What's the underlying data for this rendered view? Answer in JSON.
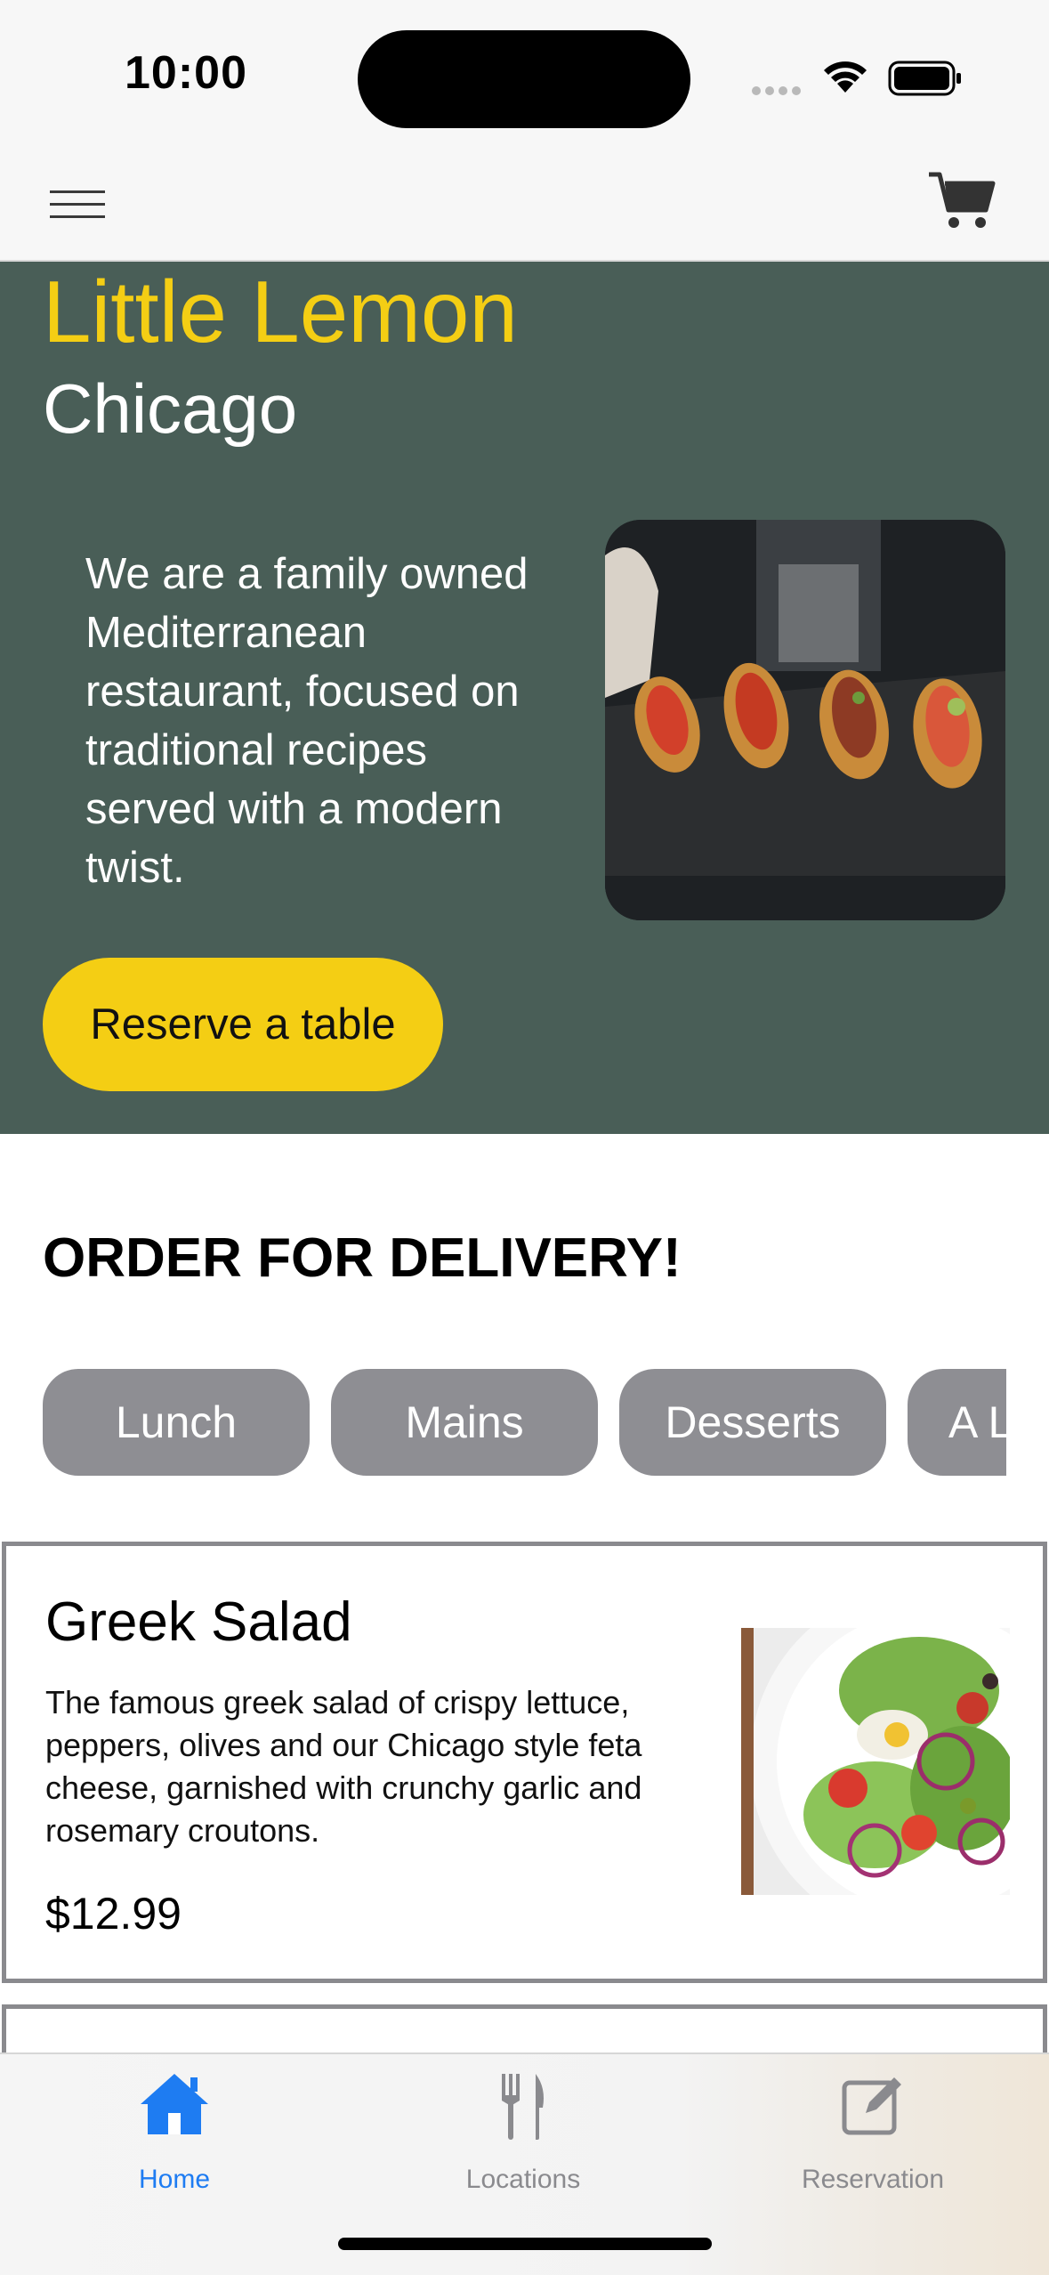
{
  "status_bar": {
    "time": "10:00"
  },
  "hero": {
    "title": "Little Lemon",
    "city": "Chicago",
    "description": "We are a family owned Mediterranean restaurant, focused on traditional recipes served with a modern twist.",
    "reserve_label": "Reserve a table"
  },
  "delivery": {
    "title": "ORDER FOR DELIVERY!",
    "categories": [
      "Lunch",
      "Mains",
      "Desserts",
      "A La Carte"
    ]
  },
  "menu_items": [
    {
      "name": "Greek Salad",
      "description": "The famous greek salad of crispy lettuce, peppers, olives and our Chicago style feta cheese, garnished with crunchy garlic and rosemary croutons.",
      "price": "$12.99"
    }
  ],
  "tabs": [
    {
      "label": "Home",
      "icon": "house-icon",
      "active": true
    },
    {
      "label": "Locations",
      "icon": "fork-knife-icon",
      "active": false
    },
    {
      "label": "Reservation",
      "icon": "edit-icon",
      "active": false
    }
  ],
  "colors": {
    "hero_background": "#495e57",
    "brand_yellow": "#f4ce14",
    "pill_gray": "#8e8e93",
    "tab_active": "#1e7cf2",
    "tab_inactive": "#8a8a8e"
  }
}
